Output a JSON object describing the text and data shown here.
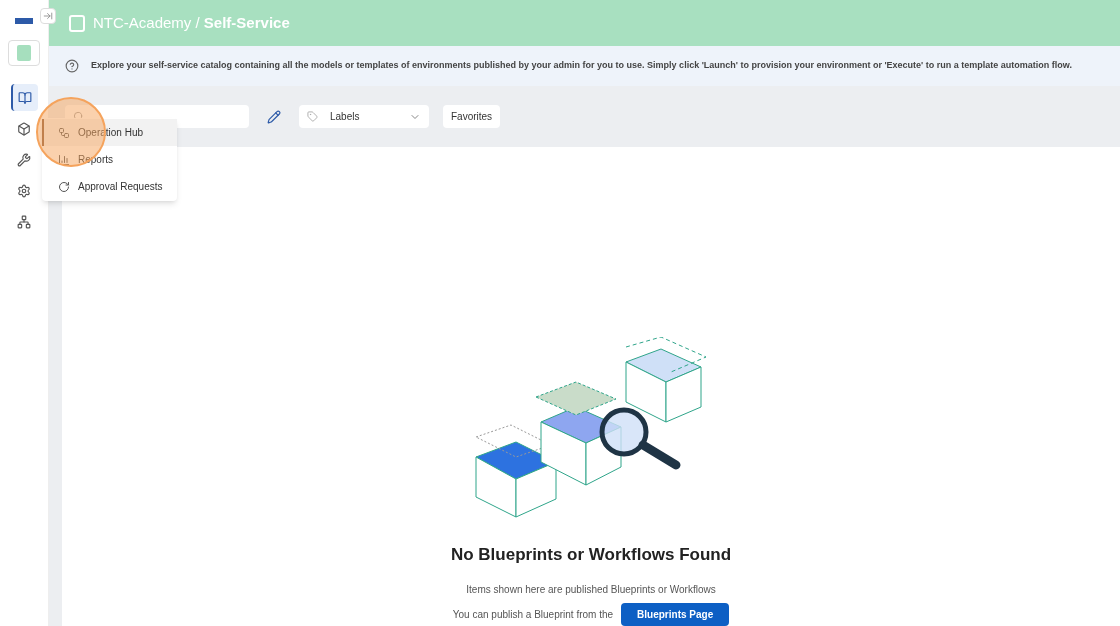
{
  "header": {
    "workspace": "NTC-Academy /",
    "page": "Self-Service"
  },
  "info": "Explore your self-service catalog containing all the models or templates of environments published by your admin for you to use. Simply click 'Launch' to provision your environment or 'Execute' to run a template automation flow.",
  "sidebar": {
    "items": [
      {
        "kind": "book",
        "selected": true
      },
      {
        "kind": "cube",
        "selected": false
      },
      {
        "kind": "tools",
        "selected": false
      },
      {
        "kind": "gear",
        "selected": false
      },
      {
        "kind": "tree",
        "selected": false
      }
    ]
  },
  "toolbar": {
    "labels": "Labels",
    "favorites": "Favorites"
  },
  "menu": [
    {
      "kind": "hub",
      "label": "Operation Hub",
      "selected": true
    },
    {
      "kind": "chart",
      "label": "Reports",
      "selected": false
    },
    {
      "kind": "approval",
      "label": "Approval Requests",
      "selected": false
    }
  ],
  "empty": {
    "title": "No Blueprints or Workflows Found",
    "subtitle": "Items shown here are published Blueprints or Workflows",
    "hint": "You can publish a Blueprint from the",
    "button": "Blueprints Page"
  }
}
